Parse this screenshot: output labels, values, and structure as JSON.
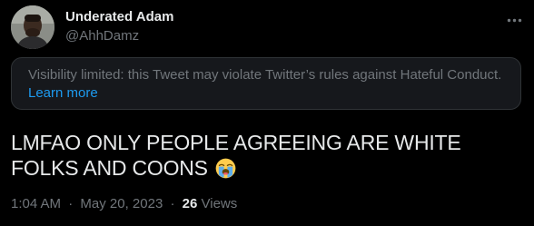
{
  "author": {
    "display_name": "Underated Adam",
    "handle": "@AhhDamz"
  },
  "notice": {
    "text": "Visibility limited: this Tweet may violate Twitter’s rules against Hateful Conduct.",
    "link_label": "Learn more"
  },
  "tweet": {
    "text": "LMFAO ONLY PEOPLE AGREEING ARE WHITE FOLKS AND COONS",
    "emoji_icon": "loudly-crying-face-icon"
  },
  "meta": {
    "time": "1:04 AM",
    "separator": "·",
    "date": "May 20, 2023",
    "views_count": "26",
    "views_label": "Views"
  },
  "colors": {
    "background": "#000000",
    "primary_text": "#e7e9ea",
    "secondary_text": "#71767b",
    "link": "#1d9bf0",
    "notice_border": "#2f3336"
  }
}
